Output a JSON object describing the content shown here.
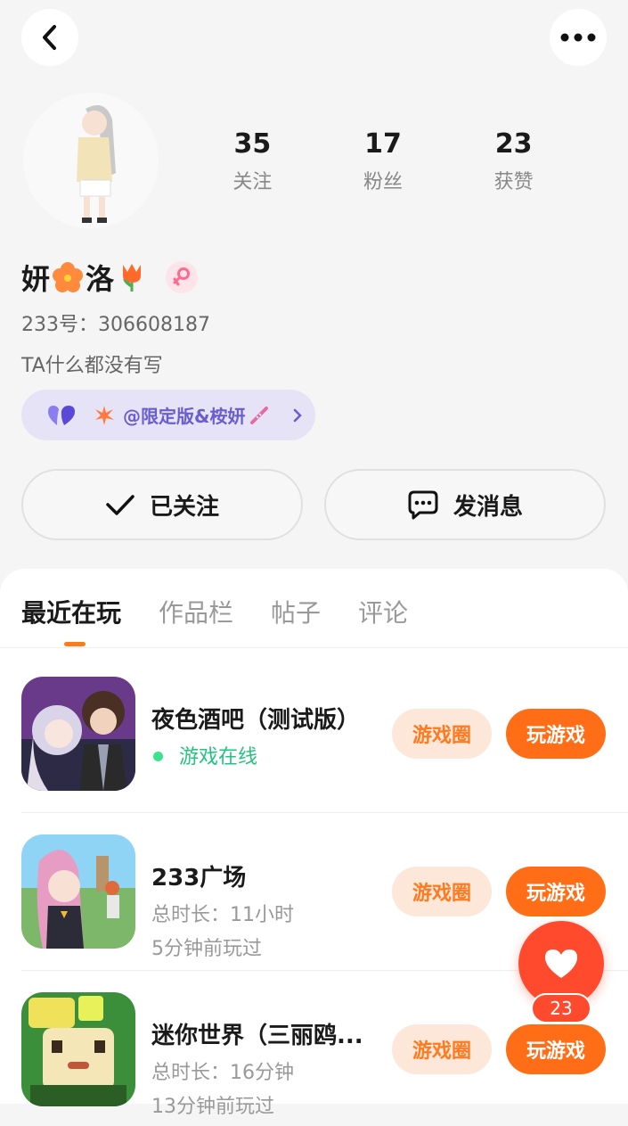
{
  "header": {
    "back_icon": "chevron-left-icon",
    "more_icon": "more-horizontal-icon"
  },
  "profile": {
    "stats": [
      {
        "value": "35",
        "label": "关注"
      },
      {
        "value": "17",
        "label": "粉丝"
      },
      {
        "value": "23",
        "label": "获赞"
      }
    ],
    "name_part1": "妍",
    "name_part2": "洛",
    "gender_icon": "female-icon",
    "uid": "233号：306608187",
    "bio": "TA什么都没有写",
    "tag": {
      "text": "@限定版&桉妍",
      "icon": "purple-heart-icon"
    },
    "follow_button": "已关注",
    "message_button": "发消息"
  },
  "tabs": [
    {
      "label": "最近在玩",
      "active": true
    },
    {
      "label": "作品栏",
      "active": false
    },
    {
      "label": "帖子",
      "active": false
    },
    {
      "label": "评论",
      "active": false
    }
  ],
  "games": [
    {
      "name": "夜色酒吧（测试版）",
      "line1": "游戏在线",
      "line2": "",
      "circle_label": "游戏圈",
      "play_label": "玩游戏"
    },
    {
      "name": "233广场",
      "line1": "总时长：11小时",
      "line2": "5分钟前玩过",
      "circle_label": "游戏圈",
      "play_label": "玩游戏"
    },
    {
      "name": "迷你世界（三丽鸥...",
      "line1": "总时长：16分钟",
      "line2": "13分钟前玩过",
      "circle_label": "游戏圈",
      "play_label": "玩游戏"
    }
  ],
  "like_fab": {
    "count": "23",
    "icon": "heart-icon"
  },
  "colors": {
    "accent": "#ff6d17",
    "like": "#ff4a2e",
    "online": "#26c281",
    "tag_text": "#6a5cd1"
  }
}
